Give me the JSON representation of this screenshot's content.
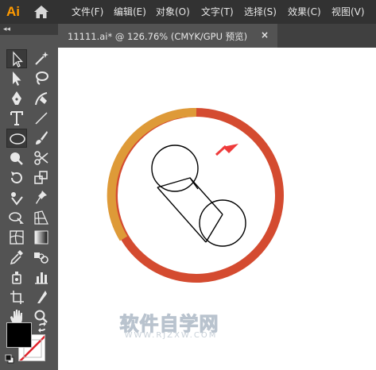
{
  "app": {
    "logo": "Ai"
  },
  "menu": [
    "文件(F)",
    "编辑(E)",
    "对象(O)",
    "文字(T)",
    "选择(S)",
    "效果(C)",
    "视图(V)"
  ],
  "document_tab": {
    "title": "11111.ai* @ 126.76% (CMYK/GPU 预览)",
    "close": "×"
  },
  "toolbar": {
    "collapse": "◂◂"
  },
  "artwork": {
    "ring_colors": {
      "orange": "#de9a38",
      "red": "#d44b30"
    },
    "arrow_color": "#ee3b3b"
  },
  "watermark": {
    "main": "软件自学网",
    "sub": "WWW.RJZXW.COM"
  }
}
